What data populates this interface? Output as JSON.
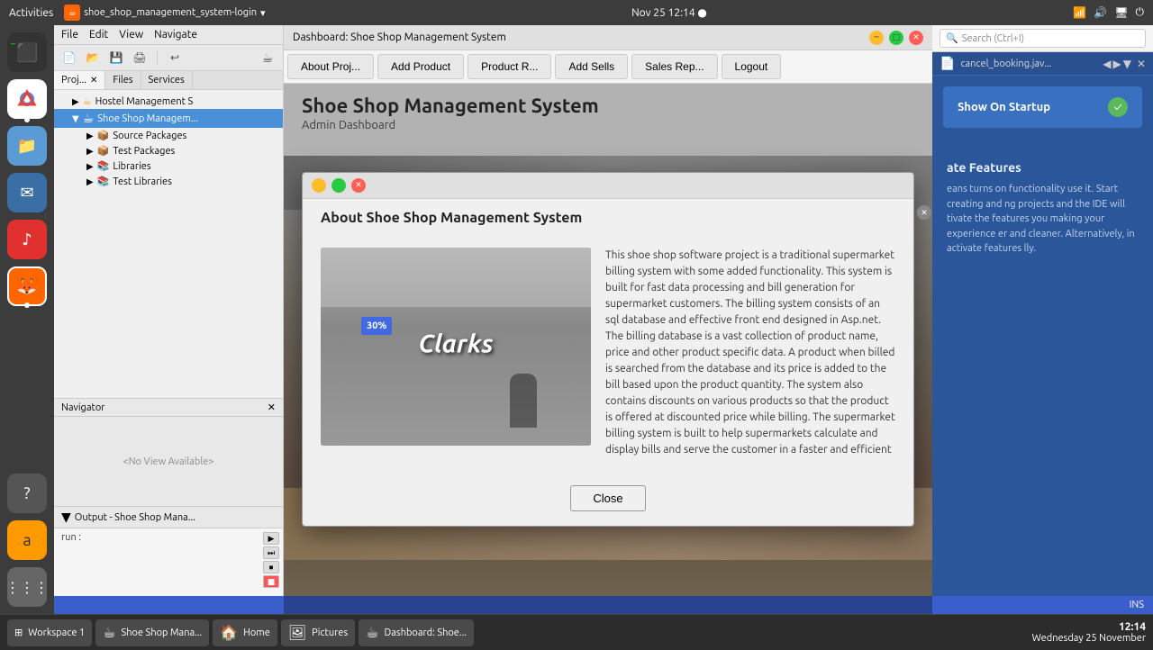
{
  "system": {
    "activities": "Activities",
    "app_name": "shoe_shop_management_system-login",
    "datetime": "Nov 25  12:14 ●",
    "taskbar_time": "12:14",
    "taskbar_date": "Wednesday 25 November"
  },
  "ide": {
    "menu_items": [
      "File",
      "Edit",
      "View",
      "Navigate"
    ],
    "tabs": [
      "Proj...",
      "Files",
      "Services"
    ],
    "title": "Dashboard: Shoe Shop Management System",
    "project_tree": [
      {
        "label": "Hostel Management S",
        "level": 1,
        "type": "project"
      },
      {
        "label": "Shoe Shop Managem...",
        "level": 1,
        "type": "project",
        "active": true
      },
      {
        "label": "Source Packages",
        "level": 2,
        "type": "folder"
      },
      {
        "label": "Test Packages",
        "level": 2,
        "type": "folder"
      },
      {
        "label": "Libraries",
        "level": 2,
        "type": "folder"
      },
      {
        "label": "Test Libraries",
        "level": 2,
        "type": "folder"
      }
    ],
    "navigator_title": "Navigator",
    "navigator_content": "<No View Available>",
    "output_title": "Output - Shoe Shop Mana...",
    "output_content": "run :"
  },
  "app": {
    "title": "Shoe Shop Management System",
    "subtitle": "Admin Dashboard",
    "nav_buttons": [
      "About Proj...",
      "Add Product",
      "Product R...",
      "Add Sells",
      "Sales Rep...",
      "Logout"
    ]
  },
  "modal": {
    "title": "About Shoe Shop Management System",
    "image_text": "Clarks",
    "sale_badge": "30%",
    "description": "This shoe shop software project is a traditional supermarket billing system with some added functionality. This system is built for fast data processing and bill generation for supermarket customers. The billing system consists of an sql database and effective front end designed in Asp.net. The billing database is a vast collection of product name, price and other product specific data. A product when billed is searched from the database and its price is added to the bill based upon the product quantity. The system also contains discounts on various products so that the product is offered at discounted price while billing. The supermarket billing system is built to help supermarkets calculate and display bills and serve the customer in a faster and efficient",
    "close_btn": "Close"
  },
  "right_panel": {
    "search_placeholder": "Search (Ctrl+I)",
    "file_name": "cancel_booking.jav...",
    "show_startup_label": "Show On Startup",
    "welcome_section_title": "ate Features",
    "welcome_text": "eans turns on functionality use it. Start creating and ng projects and the IDE will tivate the features you making your experience er and cleaner. Alternatively, in activate features lly.",
    "ins_label": "INS"
  },
  "taskbar": {
    "items": [
      {
        "label": "Workspace 1",
        "icon": "⊞"
      },
      {
        "label": "Shoe Shop Mana...",
        "icon": "☕"
      },
      {
        "label": "Home",
        "icon": "🏠"
      },
      {
        "label": "Pictures",
        "icon": "🖼"
      },
      {
        "label": "Dashboard: Shoe...",
        "icon": "☕"
      }
    ]
  }
}
